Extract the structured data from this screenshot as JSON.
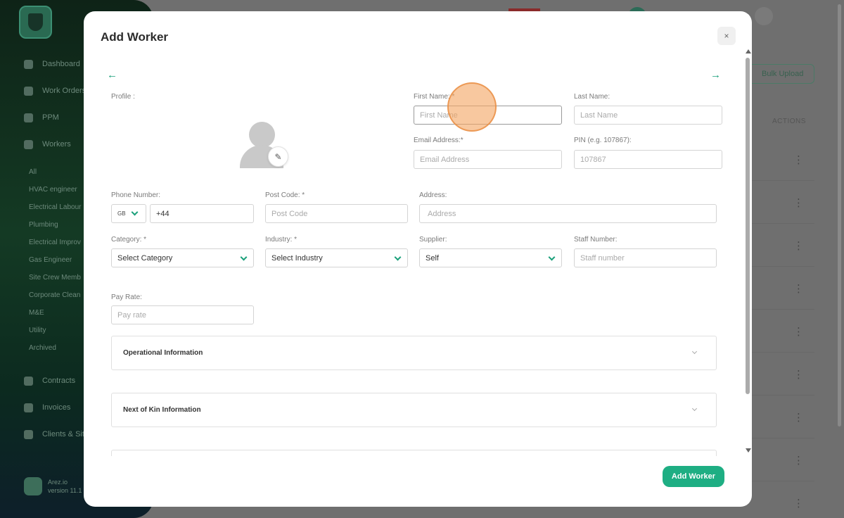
{
  "sidebar": {
    "nav": [
      {
        "label": "Dashboard",
        "icon": "dashboard-icon"
      },
      {
        "label": "Work Orders",
        "icon": "briefcase-icon"
      },
      {
        "label": "PPM",
        "icon": "clipboard-icon"
      },
      {
        "label": "Workers",
        "icon": "user-icon"
      }
    ],
    "worker_categories": [
      "All",
      "HVAC engineer",
      "Electrical Labour",
      "Plumbing",
      "Electrical Improv",
      "Gas Engineer",
      "Site Crew Memb",
      "Corporate Clean",
      "M&E",
      "Utility",
      "Archived"
    ],
    "nav_bottom": [
      {
        "label": "Contracts",
        "icon": "document-icon"
      },
      {
        "label": "Invoices",
        "icon": "invoice-icon"
      },
      {
        "label": "Clients & Sit",
        "icon": "users-icon"
      }
    ],
    "user": {
      "name": "Arez.io",
      "version": "version 11.1"
    }
  },
  "background": {
    "bulk_upload_label": "Bulk Upload",
    "actions_header": "ACTIONS",
    "row_count": 9
  },
  "modal": {
    "title": "Add Worker",
    "close_icon": "×",
    "back_arrow": "←",
    "forward_arrow": "→",
    "profile_label": "Profile :",
    "edit_icon": "✎",
    "fields": {
      "first_name": {
        "label": "First Name: *",
        "placeholder": "First Name"
      },
      "last_name": {
        "label": "Last Name:",
        "placeholder": "Last Name"
      },
      "email": {
        "label": "Email Address:*",
        "placeholder": "Email Address"
      },
      "pin": {
        "label": "PIN (e.g. 107867):",
        "placeholder": "107867"
      },
      "phone": {
        "label": "Phone Number:",
        "country_code": "GB",
        "value": "+44"
      },
      "post_code": {
        "label": "Post Code: *",
        "placeholder": "Post Code"
      },
      "address": {
        "label": "Address:",
        "placeholder": "Address"
      },
      "category": {
        "label": "Category: *",
        "value": "Select Category"
      },
      "industry": {
        "label": "Industry: *",
        "value": "Select Industry"
      },
      "supplier": {
        "label": "Supplier:",
        "value": "Self"
      },
      "staff_number": {
        "label": "Staff Number:",
        "placeholder": "Staff number"
      },
      "pay_rate": {
        "label": "Pay Rate:",
        "placeholder": "Pay rate"
      }
    },
    "sections": [
      "Operational Information",
      "Next of Kin Information"
    ],
    "submit_label": "Add Worker"
  },
  "colors": {
    "accent": "#1eae83",
    "click_marker": "#f4a664"
  }
}
